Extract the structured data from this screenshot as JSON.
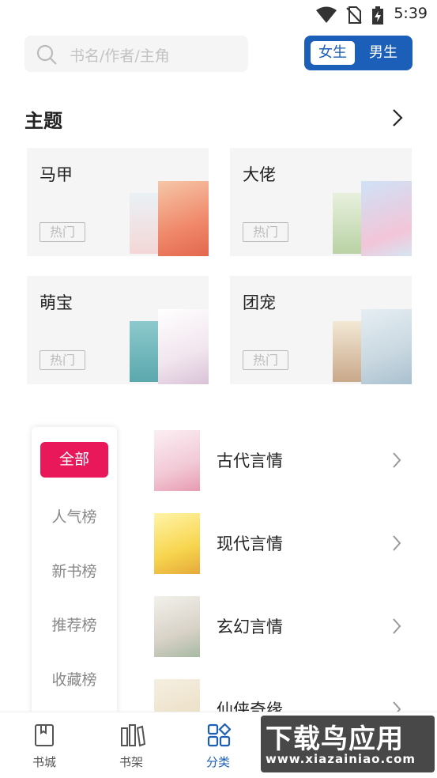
{
  "status_bar": {
    "time": "5:39",
    "icons": [
      "wifi-icon",
      "no-sim-icon",
      "battery-charging-icon"
    ]
  },
  "search": {
    "placeholder": "书名/作者/主角"
  },
  "gender_toggle": {
    "female": "女生",
    "male": "男生",
    "selected": "female"
  },
  "theme_section": {
    "title": "主题"
  },
  "theme_cards": [
    {
      "name": "马甲",
      "tag": "热门"
    },
    {
      "name": "大佬",
      "tag": "热门"
    },
    {
      "name": "萌宝",
      "tag": "热门"
    },
    {
      "name": "团宠",
      "tag": "热门"
    }
  ],
  "ranking_menu": {
    "items": [
      "全部",
      "人气榜",
      "新书榜",
      "推荐榜",
      "收藏榜"
    ],
    "active": "全部"
  },
  "categories": [
    {
      "label": "古代言情"
    },
    {
      "label": "现代言情"
    },
    {
      "label": "玄幻言情"
    },
    {
      "label": "仙侠奇缘"
    }
  ],
  "bottom_nav": {
    "items": [
      "书城",
      "书架",
      "分类"
    ],
    "active": "分类"
  },
  "watermark": {
    "title": "下载鸟应用",
    "url": "www.xiazainiao.com"
  },
  "colors": {
    "accent_blue": "#1c5fb8",
    "accent_pink": "#e8185a",
    "card_bg": "#f5f5f5"
  }
}
